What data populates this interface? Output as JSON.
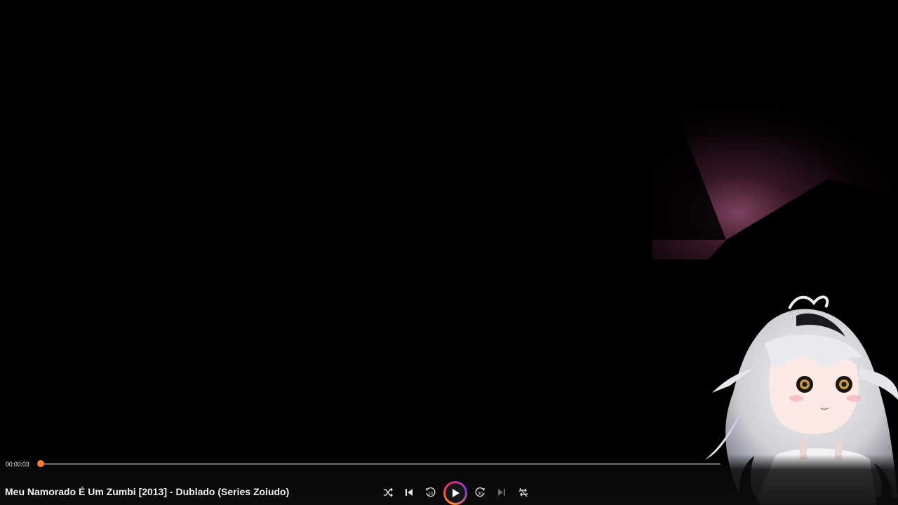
{
  "player": {
    "current_time": "00:00:03",
    "progress": 0.001,
    "title": "Meu Namorado É Um Zumbi [2013] - Dublado (Series Zoiudo)"
  },
  "controls": {
    "shuffle_icon": "shuffle-icon",
    "previous_icon": "skip-previous-icon",
    "rewind_icon": "rewind-10-icon",
    "rewind_label": "10",
    "play_icon": "play-icon",
    "forward_icon": "forward-30-icon",
    "forward_label": "30",
    "next_icon": "skip-next-icon",
    "repeat_icon": "repeat-off-icon"
  },
  "colors": {
    "accent": "#ff6a2b",
    "track": "#5a5a5a"
  }
}
